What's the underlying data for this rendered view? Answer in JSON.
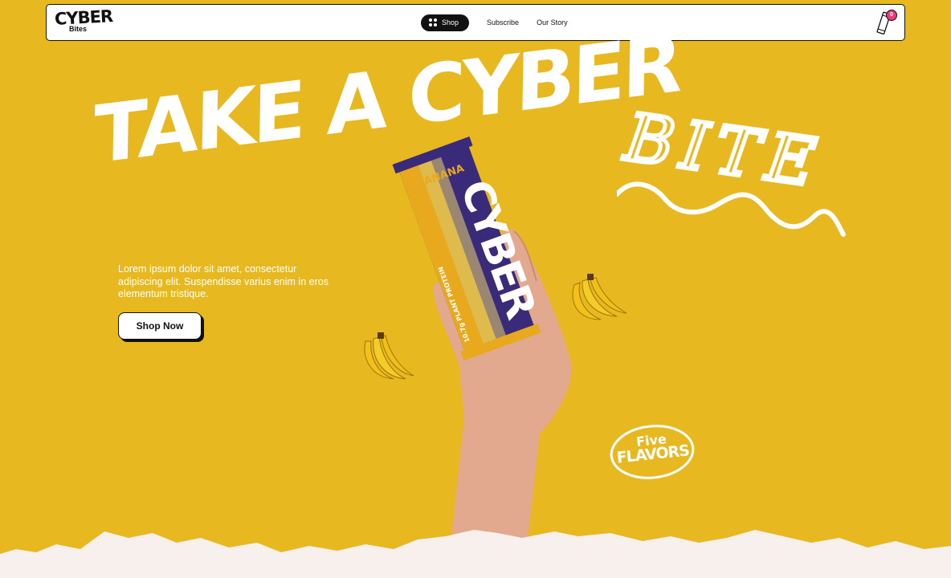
{
  "brand": {
    "logo_main": "CYBER",
    "logo_sub": "Bites"
  },
  "nav": {
    "shop": "Shop",
    "subscribe": "Subscribe",
    "story": "Our Story"
  },
  "cart": {
    "count": "0"
  },
  "hero": {
    "headline": "TAKE A CYBER",
    "script_word": "BITE",
    "description": "Lorem ipsum dolor sit amet, consectetur adipiscing elit. Suspendisse varius enim in eros elementum tristique.",
    "cta": "Shop Now"
  },
  "product": {
    "brand": "CYBER",
    "flavor": "BANANA",
    "protein": "10.7g PLANT PROTEIN"
  },
  "badge": {
    "line1": "Five",
    "line2": "FLAVORS"
  },
  "colors": {
    "background": "#E8B820",
    "text": "#FFFFFF",
    "dark": "#111111",
    "accent": "#E93A7D",
    "wrapper": "#3A2A7A",
    "paper": "#F8F0EC"
  }
}
